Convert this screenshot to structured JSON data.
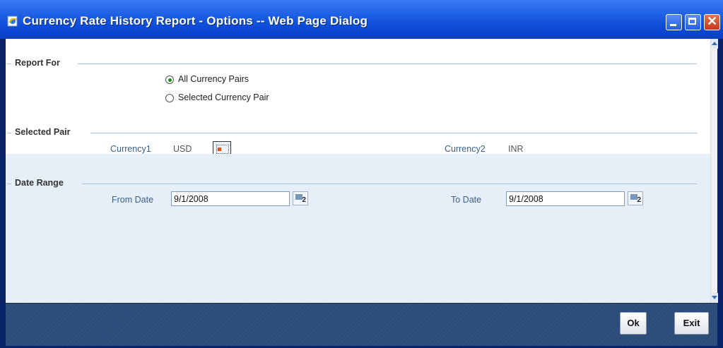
{
  "window": {
    "title": "Currency Rate History Report - Options -- Web Page Dialog",
    "icon": "ie-page-icon"
  },
  "report_for": {
    "heading": "Report For",
    "options": [
      {
        "label": "All Currency Pairs",
        "selected": true
      },
      {
        "label": "Selected Currency Pair",
        "selected": false
      }
    ]
  },
  "selected_pair": {
    "heading": "Selected Pair",
    "currency1_label": "Currency1",
    "currency1_value": "USD",
    "currency2_label": "Currency2",
    "currency2_value": "INR"
  },
  "date_range": {
    "heading": "Date Range",
    "from_label": "From Date",
    "from_value": "9/1/2008",
    "to_label": "To Date",
    "to_value": "9/1/2008",
    "calendar_glyph": "2"
  },
  "footer": {
    "ok_label": "Ok",
    "exit_label": "Exit"
  },
  "colors": {
    "title_bar": "#1d5fe3",
    "lower_panel": "#e6eff8",
    "footer": "#2b4a74",
    "label_text": "#3a5f8c"
  }
}
